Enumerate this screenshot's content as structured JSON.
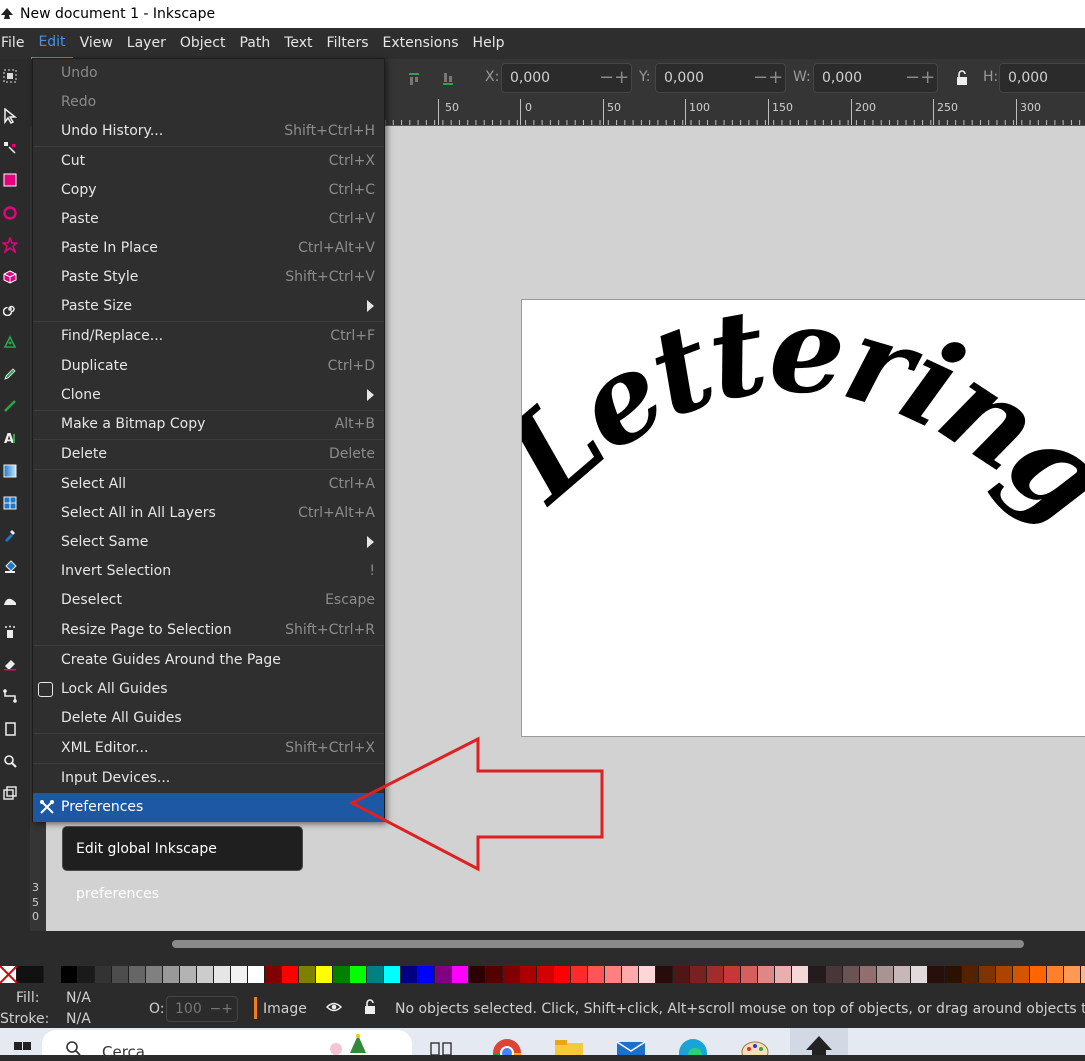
{
  "window": {
    "title": "New document 1 - Inkscape"
  },
  "menubar": [
    "File",
    "Edit",
    "View",
    "Layer",
    "Object",
    "Path",
    "Text",
    "Filters",
    "Extensions",
    "Help"
  ],
  "commandbar": {
    "x_label": "X:",
    "x_value": "0,000",
    "y_label": "Y:",
    "y_value": "0,000",
    "w_label": "W:",
    "w_value": "0,000",
    "h_label": "H:",
    "h_value": "0,000"
  },
  "ruler": {
    "labels": [
      "50",
      "0",
      "50",
      "100",
      "150",
      "200",
      "250",
      "300"
    ]
  },
  "vruler": {
    "labels": [
      "3",
      "5",
      "0"
    ]
  },
  "edit_menu": {
    "items": [
      {
        "label": "Undo",
        "shortcut": "",
        "disabled": true
      },
      {
        "label": "Redo",
        "shortcut": "",
        "disabled": true
      },
      {
        "label": "Undo History...",
        "shortcut": "Shift+Ctrl+H"
      },
      {
        "label": "Cut",
        "shortcut": "Ctrl+X"
      },
      {
        "label": "Copy",
        "shortcut": "Ctrl+C"
      },
      {
        "label": "Paste",
        "shortcut": "Ctrl+V"
      },
      {
        "label": "Paste In Place",
        "shortcut": "Ctrl+Alt+V"
      },
      {
        "label": "Paste Style",
        "shortcut": "Shift+Ctrl+V"
      },
      {
        "label": "Paste Size",
        "shortcut": "",
        "submenu": true
      },
      {
        "label": "Find/Replace...",
        "shortcut": "Ctrl+F"
      },
      {
        "label": "Duplicate",
        "shortcut": "Ctrl+D"
      },
      {
        "label": "Clone",
        "shortcut": "",
        "submenu": true
      },
      {
        "label": "Make a Bitmap Copy",
        "shortcut": "Alt+B"
      },
      {
        "label": "Delete",
        "shortcut": "Delete"
      },
      {
        "label": "Select All",
        "shortcut": "Ctrl+A"
      },
      {
        "label": "Select All in All Layers",
        "shortcut": "Ctrl+Alt+A"
      },
      {
        "label": "Select Same",
        "shortcut": "",
        "submenu": true
      },
      {
        "label": "Invert Selection",
        "shortcut": "!"
      },
      {
        "label": "Deselect",
        "shortcut": "Escape"
      },
      {
        "label": "Resize Page to Selection",
        "shortcut": "Shift+Ctrl+R"
      },
      {
        "label": "Create Guides Around the Page",
        "shortcut": ""
      },
      {
        "label": "Lock All Guides",
        "shortcut": "",
        "checkbox": true
      },
      {
        "label": "Delete All Guides",
        "shortcut": ""
      },
      {
        "label": "XML Editor...",
        "shortcut": "Shift+Ctrl+X"
      },
      {
        "label": "Input Devices...",
        "shortcut": ""
      },
      {
        "label": "Preferences",
        "shortcut": "",
        "highlighted": true
      }
    ]
  },
  "tooltip": "Edit global Inkscape preferences",
  "canvas_text": "Lettering",
  "status": {
    "fill_label": "Fill:",
    "fill_value": "N/A",
    "stroke_label": "Stroke:",
    "stroke_value": "N/A",
    "opacity_label": "O:",
    "opacity_value": "100",
    "layer": "Image",
    "message": "No objects selected. Click, Shift+click, Alt+scroll mouse on top of objects, or drag around objects to sele"
  },
  "taskbar": {
    "search_placeholder": "Cerca"
  },
  "palette_colors": [
    "#000000",
    "#1a1a1a",
    "#333333",
    "#4d4d4d",
    "#666666",
    "#808080",
    "#999999",
    "#b3b3b3",
    "#cccccc",
    "#e6e6e6",
    "#f2f2f2",
    "#ffffff",
    "#800000",
    "#ff0000",
    "#808000",
    "#ffff00",
    "#008000",
    "#00ff00",
    "#008080",
    "#00ffff",
    "#000080",
    "#0000ff",
    "#800080",
    "#ff00ff",
    "#2b0000",
    "#550000",
    "#800000",
    "#aa0000",
    "#d40000",
    "#ff0000",
    "#ff2a2a",
    "#ff5555",
    "#ff8080",
    "#ffaaaa",
    "#ffd5d5",
    "#280b0b",
    "#501616",
    "#782121",
    "#a02c2c",
    "#c83737",
    "#d35f5f",
    "#de8787",
    "#e9afaf",
    "#f4d7d7",
    "#241c1c",
    "#483737",
    "#6c5353",
    "#916f6f",
    "#ac9393",
    "#c8b7b7",
    "#e3dbdb",
    "#280f0b",
    "#2b1100",
    "#552200",
    "#803300",
    "#aa4400",
    "#d45500",
    "#ff6600",
    "#ff7f2a",
    "#ff9955",
    "#ffb380",
    "#ffccaa",
    "#ffe6d5"
  ]
}
